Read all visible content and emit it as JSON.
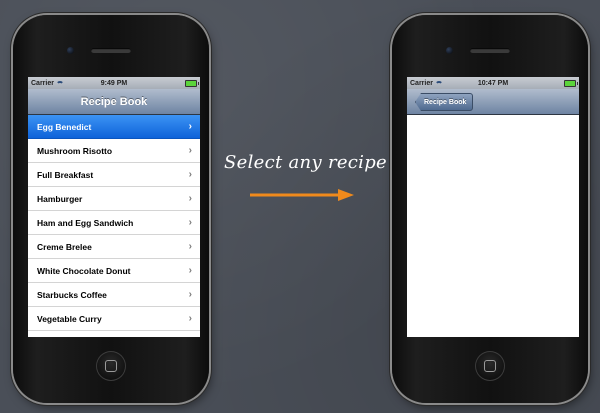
{
  "left_phone": {
    "status": {
      "carrier": "Carrier",
      "time": "9:49 PM"
    },
    "nav": {
      "title": "Recipe Book"
    },
    "recipes": [
      {
        "label": "Egg Benedict",
        "selected": true
      },
      {
        "label": "Mushroom Risotto",
        "selected": false
      },
      {
        "label": "Full Breakfast",
        "selected": false
      },
      {
        "label": "Hamburger",
        "selected": false
      },
      {
        "label": "Ham and Egg Sandwich",
        "selected": false
      },
      {
        "label": "Creme Brelee",
        "selected": false
      },
      {
        "label": "White Chocolate Donut",
        "selected": false
      },
      {
        "label": "Starbucks Coffee",
        "selected": false
      },
      {
        "label": "Vegetable Curry",
        "selected": false
      }
    ]
  },
  "right_phone": {
    "status": {
      "carrier": "Carrier",
      "time": "10:47 PM"
    },
    "nav": {
      "back_label": "Recipe Book"
    }
  },
  "caption": {
    "text": "Select any recipe"
  },
  "colors": {
    "background": "#4a4f58",
    "arrow": "#f08a1c",
    "selection": "#1a6fe0"
  },
  "icons": {
    "row_accessory": "chevron-right-icon",
    "wifi": "wifi-icon",
    "battery": "battery-icon"
  }
}
